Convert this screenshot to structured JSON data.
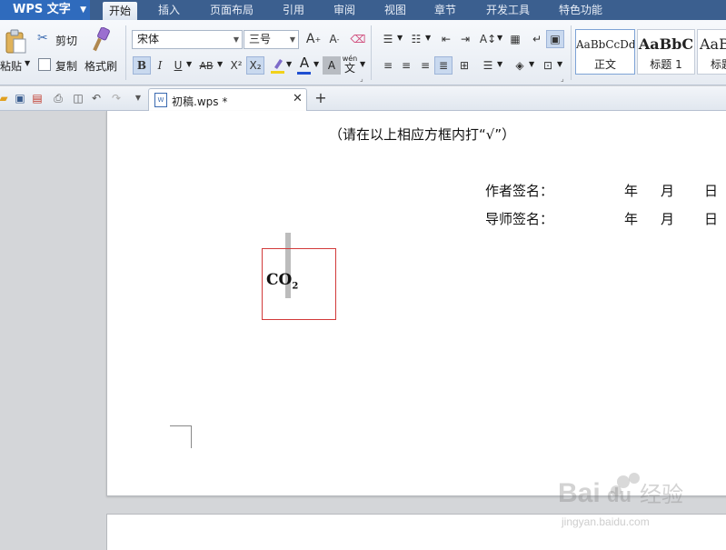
{
  "app": {
    "title": "WPS 文字"
  },
  "menu": {
    "tabs": [
      {
        "label": "开始",
        "active": true
      },
      {
        "label": "插入"
      },
      {
        "label": "页面布局"
      },
      {
        "label": "引用"
      },
      {
        "label": "审阅"
      },
      {
        "label": "视图"
      },
      {
        "label": "章节"
      },
      {
        "label": "开发工具"
      },
      {
        "label": "特色功能"
      }
    ]
  },
  "ribbon": {
    "paste_label": "粘贴",
    "cut_label": "剪切",
    "copy_label": "复制",
    "format_painter_label": "格式刷",
    "font_name": "宋体",
    "font_size": "三号",
    "bold": "B",
    "italic": "I",
    "underline": "U",
    "strikethrough": "AB",
    "superscript": "X²",
    "subscript": "X₂",
    "font_color_glyph": "A",
    "char_shading_glyph": "A",
    "phonetic_glyph": "wén",
    "styles": [
      {
        "sample": "AaBbCcDd",
        "name": "正文"
      },
      {
        "sample": "AaBbC",
        "name": "标题 1"
      },
      {
        "sample": "AaBl",
        "name": "标题"
      }
    ]
  },
  "doc_tab": {
    "filename": "初稿.wps *"
  },
  "document": {
    "line_instructions": "（请在以上相应方框内打“√”）",
    "author_sign_label": "作者签名：",
    "advisor_sign_label": "导师签名：",
    "year": "年",
    "month": "月",
    "day": "日",
    "textbox_formula_main": "CO",
    "textbox_formula_sub": "2"
  },
  "watermark": {
    "logo": "Bai du 经验",
    "url": "jingyan.baidu.com"
  },
  "colors": {
    "menubar": "#3b5f8f",
    "app_button": "#2f6bbd",
    "textbox_border": "#d23a3a",
    "font_color_bar": "#1f4fd1",
    "highlight_bar": "#f2d21b"
  }
}
